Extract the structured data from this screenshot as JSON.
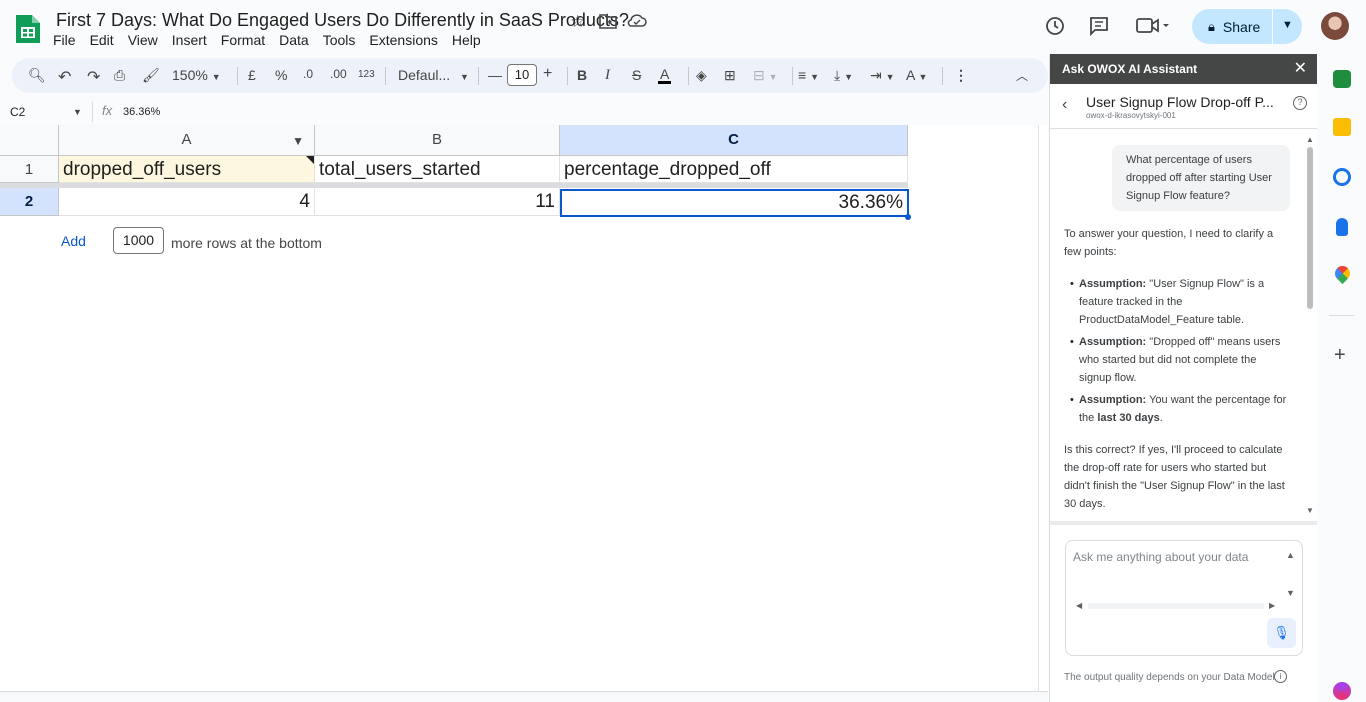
{
  "doc": {
    "title": "First 7 Days: What Do Engaged Users Do Differently in SaaS Products?",
    "menu": [
      "File",
      "Edit",
      "View",
      "Insert",
      "Format",
      "Data",
      "Tools",
      "Extensions",
      "Help"
    ],
    "share_label": "Share"
  },
  "toolbar": {
    "zoom": "150%",
    "currency": "£",
    "percent": "%",
    "decimal_decrease": ".0",
    "decimal_increase": ".00",
    "number_format": "123",
    "font": "Defaul...",
    "font_size": "10",
    "bold": "B",
    "italic": "I",
    "strike": "S",
    "text_color": "A"
  },
  "formula_bar": {
    "name_box": "C2",
    "fx": "fx",
    "value": "36.36%"
  },
  "sheet": {
    "columns": [
      "A",
      "B",
      "C"
    ],
    "rows": [
      "1",
      "2"
    ],
    "header_row": [
      "dropped_off_users",
      "total_users_started",
      "percentage_dropped_off"
    ],
    "data_row": [
      "4",
      "11",
      "36.36%"
    ],
    "selected_cell": "C2",
    "add_button": "Add",
    "add_rows_value": "1000",
    "add_rows_text": "more rows at the bottom"
  },
  "panel": {
    "header": "Ask OWOX AI Assistant",
    "title": "User Signup Flow Drop-off P...",
    "subtitle": "owox-d-ikrasovytskyi-001",
    "user_question": "What percentage of users dropped off after starting User Signup Flow feature?",
    "intro": "To answer your question, I need to clarify a few points:",
    "assumptions": [
      {
        "label": "Assumption:",
        "text": "\"User Signup Flow\" is a feature tracked in the ProductDataModel_Feature table."
      },
      {
        "label": "Assumption:",
        "text": "\"Dropped off\" means users who started but did not complete the signup flow."
      },
      {
        "label": "Assumption:",
        "text_before": "You want the percentage for the ",
        "bold": "last 30 days",
        "text_after": "."
      }
    ],
    "closing": "Is this correct? If yes, I'll proceed to calculate the drop-off rate for users who started but didn't finish the \"User Signup Flow\" in the last 30 days.",
    "input_placeholder": "Ask me anything about your data",
    "footer": "The output quality depends on your Data Model"
  },
  "colors": {
    "accent": "#0b57d0",
    "share_bg": "#c2e7ff",
    "header_highlight": "#fef7e0",
    "selected_header": "#d3e3fd"
  }
}
